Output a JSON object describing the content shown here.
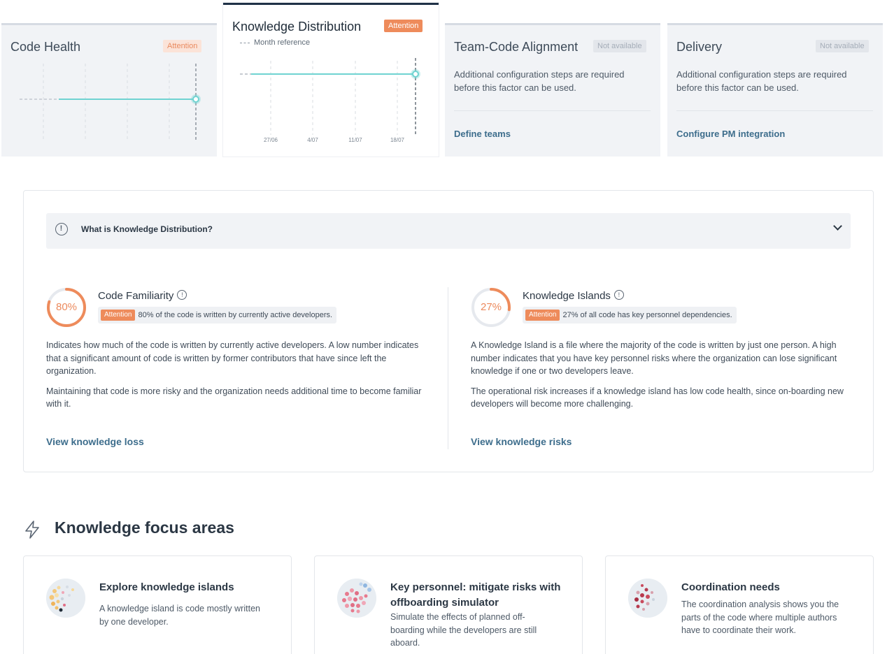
{
  "factors": {
    "code_health": {
      "title": "Code Health",
      "badge": "Attention"
    },
    "knowledge_distribution": {
      "title": "Knowledge Distribution",
      "badge": "Attention",
      "legend": "Month reference",
      "ticks": [
        "27/06",
        "4/07",
        "11/07",
        "18/07"
      ]
    },
    "team_code_alignment": {
      "title": "Team-Code Alignment",
      "badge": "Not available",
      "text": "Additional configuration steps are required before this factor can be used.",
      "link": "Define teams"
    },
    "delivery": {
      "title": "Delivery",
      "badge": "Not available",
      "text": "Additional configuration steps are required before this factor can be used.",
      "link": "Configure PM integration"
    }
  },
  "info": {
    "accordion_title": "What is Knowledge Distribution?",
    "code_familiarity": {
      "value": "80%",
      "percent": 80,
      "title": "Code Familiarity",
      "badge": "Attention",
      "summary": "80% of the code is written by currently active developers.",
      "desc1": "Indicates how much of the code is written by currently active developers. A low number indicates that a significant amount of code is written by former contributors that have since left the organization.",
      "desc2": "Maintaining that code is more risky and the organization needs additional time to become familiar with it.",
      "link": "View knowledge loss"
    },
    "knowledge_islands": {
      "value": "27%",
      "percent": 27,
      "title": "Knowledge Islands",
      "badge": "Attention",
      "summary": "27% of all code has key personnel dependencies.",
      "desc1": "A Knowledge Island is a file where the majority of the code is written by just one person. A high number indicates that you have key personnel risks where the organization can lose significant knowledge if one or two developers leave.",
      "desc2": "The operational risk increases if a knowledge island has low code health, since on-boarding new developers will become more challenging.",
      "link": "View knowledge risks"
    }
  },
  "focus": {
    "heading": "Knowledge focus areas",
    "cards": [
      {
        "title": "Explore knowledge islands",
        "desc": "A knowledge island is code mostly written by one developer."
      },
      {
        "title": "Key personnel: mitigate risks with offboarding simulator",
        "desc": "Simulate the effects of planned off-boarding while the developers are still aboard."
      },
      {
        "title": "Coordination needs",
        "desc": "The coordination analysis shows you the parts of the code where multiple authors have to coordinate their work."
      }
    ]
  },
  "colors": {
    "attention": "#ee8b5b",
    "link": "#3d6d8c",
    "trend": "#6fd3d1"
  }
}
